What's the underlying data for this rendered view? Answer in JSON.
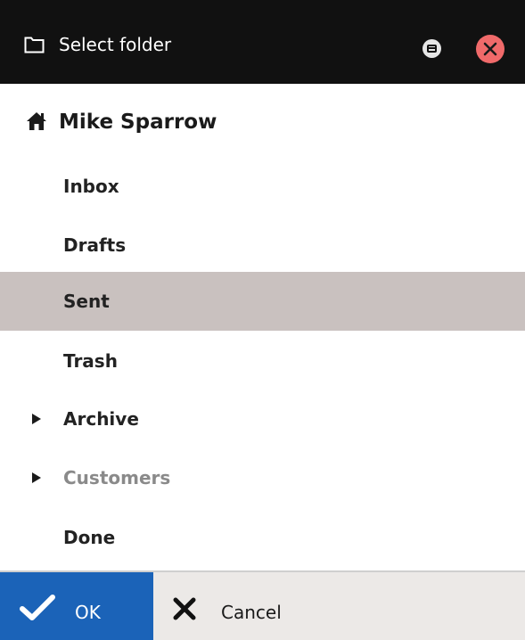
{
  "dialog": {
    "title": "Select folder",
    "title_icon": "folder-icon",
    "controls": [
      {
        "name": "restore",
        "icon": "restore-icon"
      },
      {
        "name": "close",
        "icon": "close-icon"
      }
    ]
  },
  "tree": {
    "account": {
      "label": "Mike Sparrow",
      "icon": "home-icon"
    },
    "folders": [
      {
        "label": "Inbox",
        "selected": false,
        "expandable": false,
        "muted": false
      },
      {
        "label": "Drafts",
        "selected": false,
        "expandable": false,
        "muted": false
      },
      {
        "label": "Sent",
        "selected": true,
        "expandable": false,
        "muted": false
      },
      {
        "label": "Trash",
        "selected": false,
        "expandable": false,
        "muted": false
      },
      {
        "label": "Archive",
        "selected": false,
        "expandable": true,
        "muted": false
      },
      {
        "label": "Customers",
        "selected": false,
        "expandable": true,
        "muted": true
      },
      {
        "label": "Done",
        "selected": false,
        "expandable": false,
        "muted": false
      }
    ]
  },
  "footer": {
    "ok_label": "OK",
    "cancel_label": "Cancel"
  },
  "colors": {
    "titlebar": "#111111",
    "close": "#f06a6a",
    "selected_row": "#c9c1bf",
    "ok_button": "#1b63b8",
    "footer": "#ece9e7",
    "muted_text": "#8a8a8a"
  }
}
